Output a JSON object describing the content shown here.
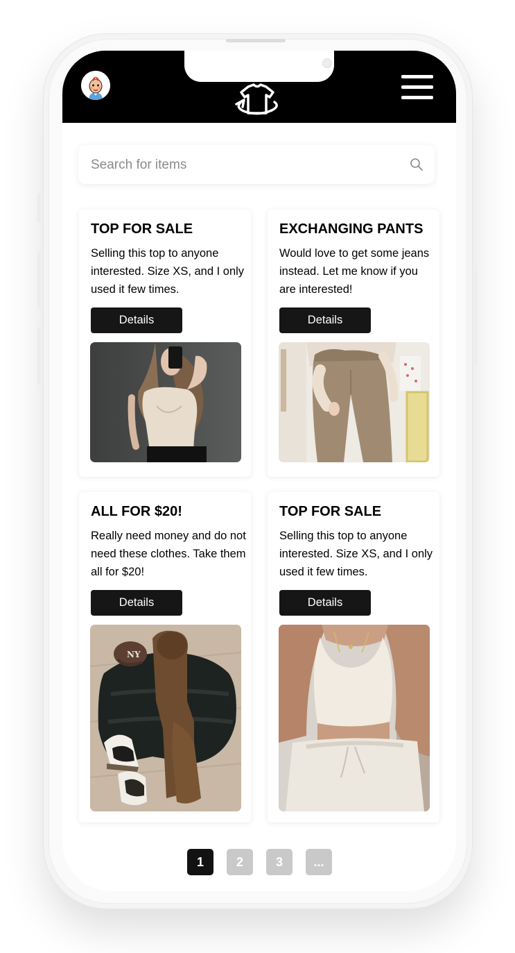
{
  "app": {
    "accent": "#000000",
    "background": "#ffffff"
  },
  "header": {
    "avatar_icon": "user-avatar",
    "logo_icon": "tshirt-swap-logo",
    "menu_icon": "hamburger-menu-icon"
  },
  "search": {
    "placeholder": "Search for items",
    "value": "",
    "icon": "search-icon"
  },
  "listings": [
    {
      "title": "TOP FOR SALE",
      "description": "Selling this top to anyone interested. Size XS, and I only used it few times.",
      "button_label": "Details",
      "photo": "woman-beige-bodysuit-mirror-selfie"
    },
    {
      "title": "EXCHANGING PANTS",
      "description": "Would love to get some jeans instead. Let me know if you are interested!",
      "button_label": "Details",
      "photo": "beige-trousers"
    },
    {
      "title": "ALL FOR $20!",
      "description": "Really need money and do not need these clothes. Take them all for $20!",
      "button_label": "Details",
      "photo": "clothes-flat-lay-jacket-cap-sneakers"
    },
    {
      "title": "TOP FOR SALE",
      "description": "Selling this top to anyone interested. Size XS, and I only used it few times.",
      "button_label": "Details",
      "photo": "beige-tank-top-sweatpants"
    }
  ],
  "pagination": {
    "pages": [
      "1",
      "2",
      "3",
      "..."
    ],
    "current": "1"
  }
}
